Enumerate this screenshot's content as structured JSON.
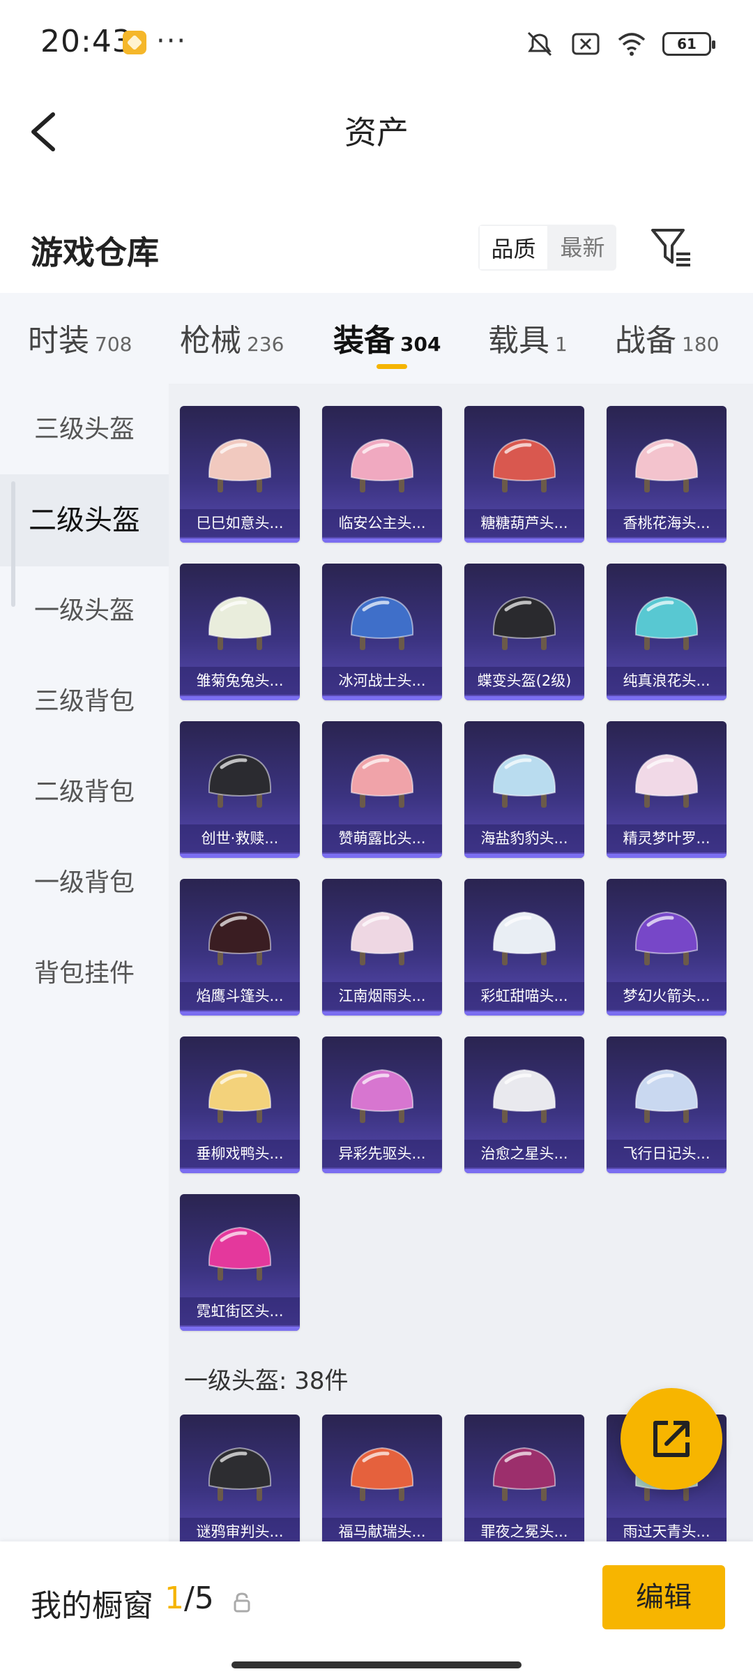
{
  "status_bar": {
    "time": "20:43",
    "dots": "···",
    "battery": "61"
  },
  "header": {
    "title": "资产"
  },
  "warehouse": {
    "title": "游戏仓库",
    "sort_options": [
      "品质",
      "最新"
    ],
    "active_sort": "品质"
  },
  "tabs": [
    {
      "label": "时装",
      "count": "708"
    },
    {
      "label": "枪械",
      "count": "236"
    },
    {
      "label": "装备",
      "count": "304"
    },
    {
      "label": "载具",
      "count": "1"
    },
    {
      "label": "战备",
      "count": "180"
    }
  ],
  "active_tab": "装备",
  "sidebar": {
    "items": [
      "三级头盔",
      "二级头盔",
      "一级头盔",
      "三级背包",
      "二级背包",
      "一级背包",
      "背包挂件"
    ],
    "active": "二级头盔"
  },
  "items": [
    {
      "name": "巳巳如意头...",
      "color": "#f1c9bf"
    },
    {
      "name": "临安公主头...",
      "color": "#f0a9c0"
    },
    {
      "name": "糖糖葫芦头...",
      "color": "#d9584f"
    },
    {
      "name": "香桃花海头...",
      "color": "#f3c3cd"
    },
    {
      "name": "雏菊兔兔头...",
      "color": "#e9eddc"
    },
    {
      "name": "冰河战士头...",
      "color": "#3f6fc9"
    },
    {
      "name": "蝶变头盔(2级)",
      "color": "#2a2a2e"
    },
    {
      "name": "纯真浪花头...",
      "color": "#58c8d2"
    },
    {
      "name": "创世·救赎...",
      "color": "#2b2b30"
    },
    {
      "name": "赞萌露比头...",
      "color": "#f0a3a9"
    },
    {
      "name": "海盐豹豹头...",
      "color": "#b9dcef"
    },
    {
      "name": "精灵梦叶罗...",
      "color": "#f1d9e7"
    },
    {
      "name": "焰鹰斗篷头...",
      "color": "#3a1d22"
    },
    {
      "name": "江南烟雨头...",
      "color": "#eed7e3"
    },
    {
      "name": "彩虹甜喵头...",
      "color": "#e9eef4"
    },
    {
      "name": "梦幻火箭头...",
      "color": "#7747c8"
    },
    {
      "name": "垂柳戏鸭头...",
      "color": "#f3d27b"
    },
    {
      "name": "异彩先驱头...",
      "color": "#d776d0"
    },
    {
      "name": "治愈之星头...",
      "color": "#e9e9ee"
    },
    {
      "name": "飞行日记头...",
      "color": "#c9d8f0"
    },
    {
      "name": "霓虹街区头...",
      "color": "#e4389c"
    }
  ],
  "section": {
    "label": "一级头盔: 38件"
  },
  "items_level1": [
    {
      "name": "谜鸦审判头...",
      "color": "#2d2d31"
    },
    {
      "name": "福马献瑞头...",
      "color": "#e5613d"
    },
    {
      "name": "罪夜之冕头...",
      "color": "#9c2f6c"
    },
    {
      "name": "雨过天青头...",
      "color": "#a7d0c3"
    }
  ],
  "bottom": {
    "showcase_label": "我的橱窗",
    "current": "1",
    "total": "/5",
    "edit_label": "编辑"
  }
}
